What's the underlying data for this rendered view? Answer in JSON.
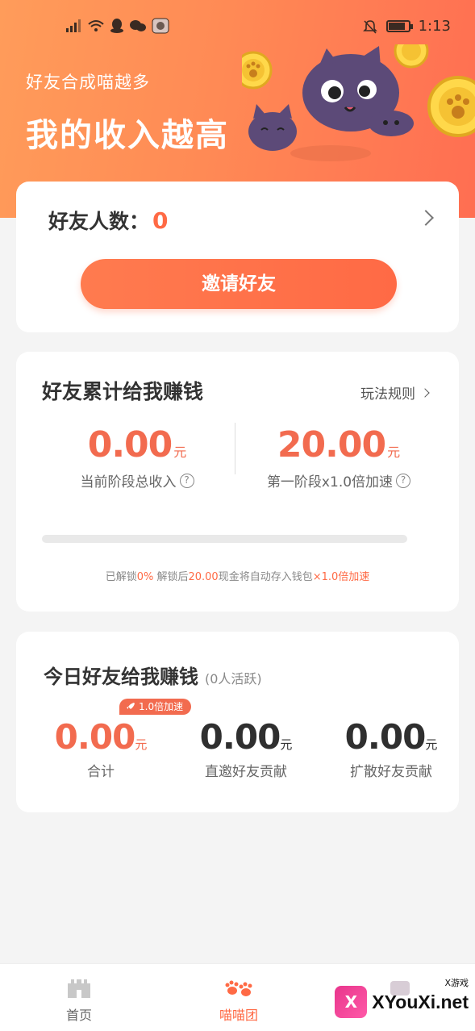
{
  "status_bar": {
    "time": "1:13",
    "left_icons": [
      "signal-icon",
      "wifi-icon",
      "qq-icon",
      "wechat-icon",
      "app-avatar-icon"
    ],
    "right_icons": [
      "mute-icon",
      "battery-icon"
    ]
  },
  "header": {
    "slogan_small": "好友合成喵越多",
    "slogan_big": "我的收入越高"
  },
  "friends_card": {
    "label": "好友人数：",
    "count": "0",
    "invite_button": "邀请好友"
  },
  "total_card": {
    "title": "好友累计给我赚钱",
    "rules_link": "玩法规则",
    "current_income": "0.00",
    "current_unit": "元",
    "current_caption": "当前阶段总收入",
    "stage_value": "20.00",
    "stage_unit": "元",
    "stage_caption": "第一阶段x1.0倍加速",
    "progress_percent": 0,
    "note_prefix": "已解锁",
    "note_percent": "0%",
    "note_mid1": " 解锁后",
    "note_amount": "20.00",
    "note_mid2": "现金将自动存入钱包",
    "note_speed": "×1.0倍加速"
  },
  "today_card": {
    "title": "今日好友给我赚钱",
    "subtitle": "(0人活跃)",
    "speed_tag": "1.0倍加速",
    "total_value": "0.00",
    "total_unit": "元",
    "total_caption": "合计",
    "direct_value": "0.00",
    "direct_unit": "元",
    "direct_caption": "直邀好友贡献",
    "spread_value": "0.00",
    "spread_unit": "元",
    "spread_caption": "扩散好友贡献"
  },
  "bottom_nav": {
    "home": "首页",
    "team": "喵喵团",
    "active": "team"
  },
  "watermark": {
    "badge": "X",
    "text": "XYouXi.net",
    "small": "X游戏"
  },
  "colors": {
    "accent": "#ff6a45",
    "header_start": "#ff9c5a",
    "header_end": "#ff6e52"
  }
}
